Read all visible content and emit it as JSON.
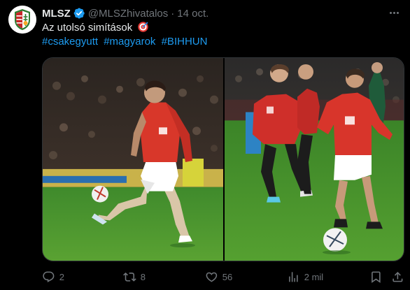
{
  "tweet": {
    "author_name": "MLSZ",
    "author_handle": "@MLSZhivatalos",
    "separator": "·",
    "date": "14 oct.",
    "text": "Az utolsó simítások",
    "hashtags": [
      "#csakegyutt",
      "#magyarok",
      "#BIHHUN"
    ],
    "avatar_icon": "mlsz-crest-icon",
    "verified_icon": "verified-badge-icon",
    "text_emoji_icon": "direct-hit-target-icon",
    "accent_color": "#1d9bf0"
  },
  "media": [
    {
      "name": "photo-player-juggling-ball",
      "kind": "image"
    },
    {
      "name": "photo-players-warmup",
      "kind": "image"
    }
  ],
  "actions": {
    "reply_count": "2",
    "retweet_count": "8",
    "like_count": "56",
    "views_count": "2 mil",
    "icons": [
      "reply-icon",
      "retweet-icon",
      "like-icon",
      "views-icon",
      "bookmark-icon",
      "share-icon"
    ]
  }
}
